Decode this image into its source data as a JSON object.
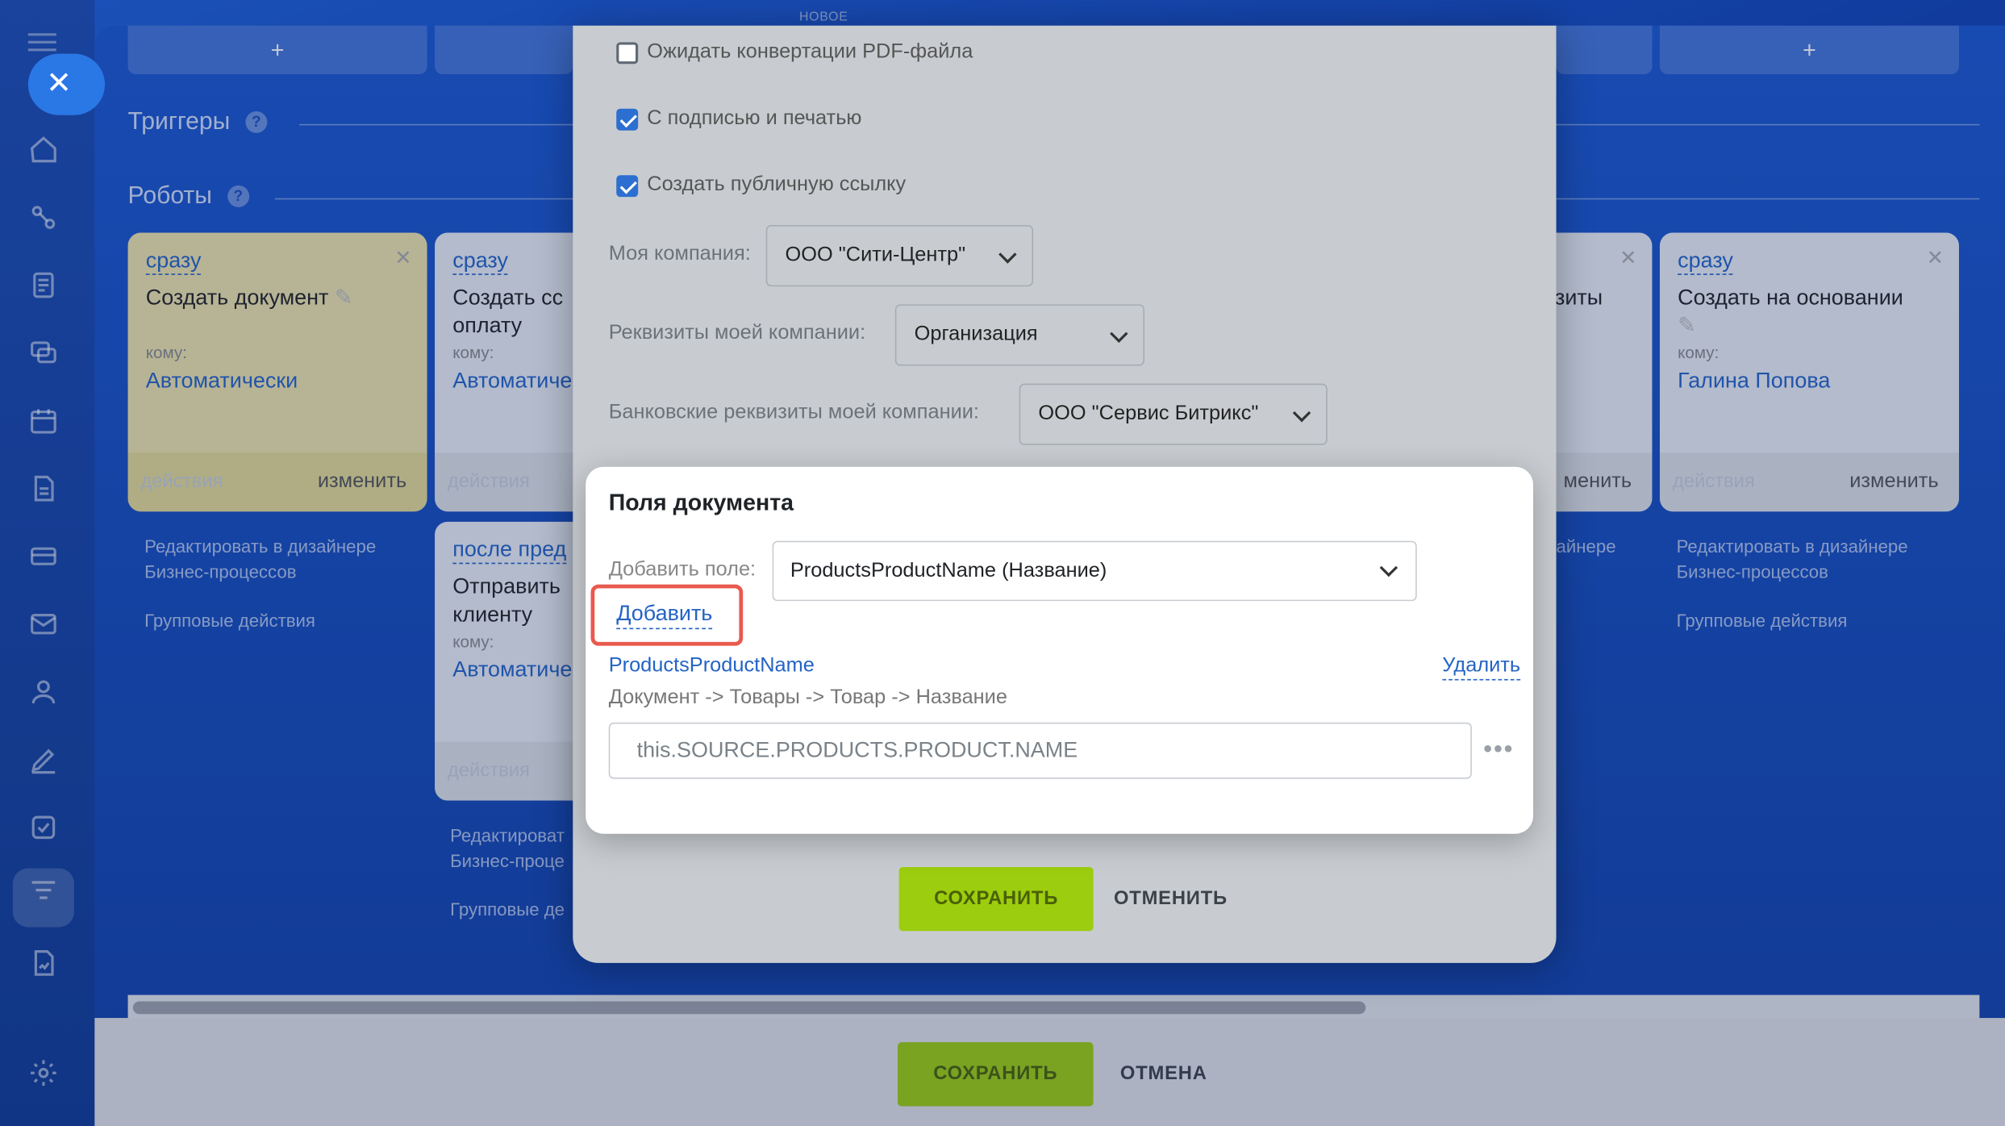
{
  "rail": {
    "icons": [
      "home-icon",
      "flow-icon",
      "document-icon",
      "chat-icon",
      "calendar-icon",
      "file-icon",
      "card-icon",
      "mail-icon",
      "contacts-icon",
      "edit-icon",
      "tasks-icon",
      "funnel-icon",
      "report-icon"
    ],
    "settings_icon": "gear-icon",
    "close_glyph": "✕"
  },
  "board": {
    "stage_label": "НОВОЕ",
    "add_glyph": "+",
    "triggers_title": "Триггеры",
    "robots_title": "Роботы",
    "help_glyph": "?",
    "cards": [
      {
        "when": "сразу",
        "title": "Создать документ",
        "to_label": "кому:",
        "who": "Автоматически",
        "footer_left": "действия",
        "footer_right": "изменить"
      },
      {
        "when": "сразу",
        "title": "Создать сс оплату",
        "to_label": "кому:",
        "who": "Автоматиче",
        "footer_left": "действия"
      },
      {
        "when": "после пред",
        "title": "Отправить клиенту",
        "to_label": "кому:",
        "who": "Автоматиче",
        "footer_left": "действия"
      },
      {
        "title": "зиты",
        "footer_right": "менить"
      },
      {
        "when": "сразу",
        "title": "Создать на основании",
        "to_label": "кому:",
        "who": "Галина Попова",
        "footer_left": "действия",
        "footer_right": "изменить"
      }
    ],
    "edit_designer_1": "Редактировать в дизайнере",
    "edit_designer_2": "Бизнес-процессов",
    "group_actions": "Групповые действия",
    "cut_designer_1": "Редактироват",
    "cut_designer_2": "Бизнес-проце",
    "cut_group": "Групповые де",
    "right_cut_designer": "айнере"
  },
  "dialog": {
    "checkboxes": [
      {
        "label": "Ожидать конвертации PDF-файла",
        "checked": false
      },
      {
        "label": "С подписью и печатью",
        "checked": true
      },
      {
        "label": "Создать публичную ссылку",
        "checked": true
      }
    ],
    "my_company_label": "Моя компания:",
    "my_company_value": "ООО \"Сити-Центр\"",
    "requisites_label": "Реквизиты моей компании:",
    "requisites_value": "Организация",
    "bank_label": "Банковские реквизиты моей компании:",
    "bank_value": "ООО \"Сервис Битрикс\"",
    "save": "СОХРАНИТЬ",
    "cancel": "ОТМЕНИТЬ"
  },
  "fields_popup": {
    "title": "Поля документа",
    "add_field_label": "Добавить поле:",
    "add_field_value": "ProductsProductName (Название)",
    "add_button": "Добавить",
    "field_name": "ProductsProductName",
    "delete": "Удалить",
    "field_path": "Документ -> Товары -> Товар -> Название",
    "field_value": "this.SOURCE.PRODUCTS.PRODUCT.NAME",
    "more_glyph": "•••"
  },
  "footer": {
    "save": "СОХРАНИТЬ",
    "cancel": "ОТМЕНА"
  },
  "colors": {
    "accent": "#2463c5",
    "save_green": "#9ccd0e",
    "highlight": "#e95a4e"
  }
}
